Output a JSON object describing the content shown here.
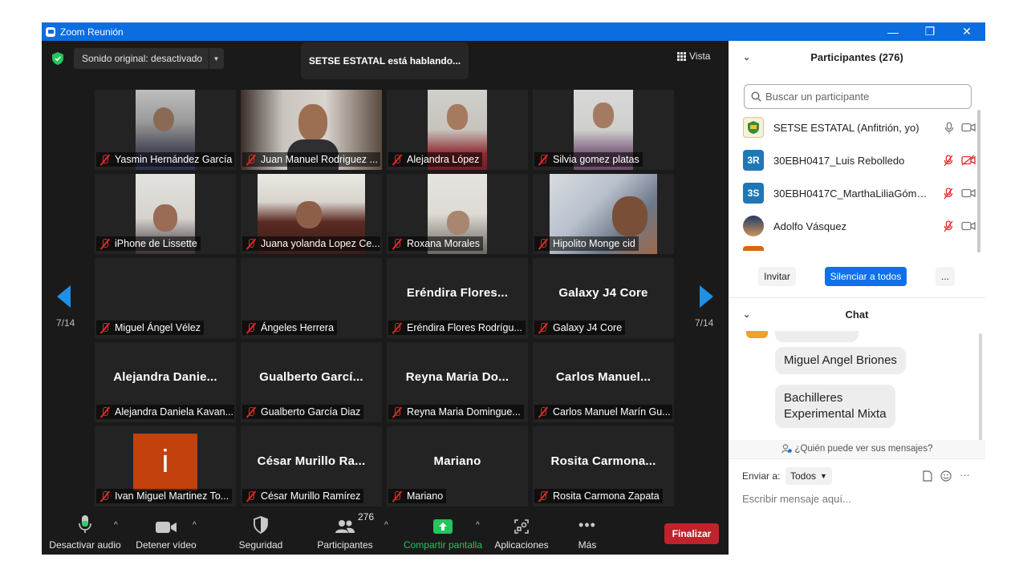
{
  "window": {
    "title": "Zoom Reunión",
    "minimize": "—",
    "maximize": "❐",
    "close": "✕"
  },
  "topbar": {
    "sound_label": "Sonido original: desactivado",
    "speaking": "SETSE ESTATAL está hablando...",
    "view_label": "Vista"
  },
  "pager": {
    "left": "7/14",
    "right": "7/14"
  },
  "tiles": [
    {
      "label": "Yasmin Hernández García"
    },
    {
      "label": "Juan Manuel Rodriguez ..."
    },
    {
      "label": "Alejandra López"
    },
    {
      "label": "Silvia gomez platas"
    },
    {
      "label": "iPhone de Lissette"
    },
    {
      "label": "Juana yolanda Lopez Ce..."
    },
    {
      "label": "Roxana Morales"
    },
    {
      "label": "Hipolito Monge  cid"
    },
    {
      "label": "Miguel Ángel Vélez"
    },
    {
      "label": "Ángeles Herrera"
    },
    {
      "big": "Eréndira  Flores...",
      "label": "Eréndira Flores Rodrígu..."
    },
    {
      "big": "Galaxy J4 Core",
      "label": "Galaxy J4 Core"
    },
    {
      "big": "Alejandra  Danie...",
      "label": "Alejandra Daniela Kavan..."
    },
    {
      "big": "Gualberto  Garcí...",
      "label": "Gualberto García Diaz"
    },
    {
      "big": "Reyna Maria Do...",
      "label": "Reyna Maria Domingue..."
    },
    {
      "big": "Carlos  Manuel...",
      "label": "Carlos Manuel Marín Gu..."
    },
    {
      "avatar_letter": "i",
      "label": "Ivan Miguel Martinez To..."
    },
    {
      "big": "César  Murillo  Ra...",
      "label": "César Murillo Ramírez"
    },
    {
      "big": "Mariano",
      "label": "Mariano"
    },
    {
      "big": "Rosita  Carmona...",
      "label": "Rosita Carmona Zapata"
    }
  ],
  "toolbar": {
    "audio": "Desactivar audio",
    "video": "Detener vídeo",
    "security": "Seguridad",
    "participants": "Participantes",
    "participants_count": "276",
    "share": "Compartir pantalla",
    "apps": "Aplicaciones",
    "more": "Más",
    "end": "Finalizar",
    "share_color": "#22c55e"
  },
  "participants": {
    "title": "Participantes (276)",
    "search_placeholder": "Buscar un participante",
    "list": [
      {
        "name": "SETSE ESTATAL (Anfitrión, yo)",
        "avatar": ""
      },
      {
        "name": "30EBH0417_Luis Rebolledo",
        "avatar": "3R"
      },
      {
        "name": "30EBH0417C_MarthaLiliaGómez...",
        "avatar": "3S"
      },
      {
        "name": "Adolfo Vásquez",
        "avatar": ""
      }
    ],
    "invite": "Invitar",
    "mute_all": "Silenciar a todos",
    "more": "..."
  },
  "chat": {
    "title": "Chat",
    "messages": [
      "Miguel Angel Briones",
      "Bachilleres\nExperimental Mixta"
    ],
    "who_can_see": "¿Quién puede ver sus mensajes?",
    "send_to_label": "Enviar a:",
    "send_to_value": "Todos",
    "input_placeholder": "Escribir mensaje aquí..."
  }
}
